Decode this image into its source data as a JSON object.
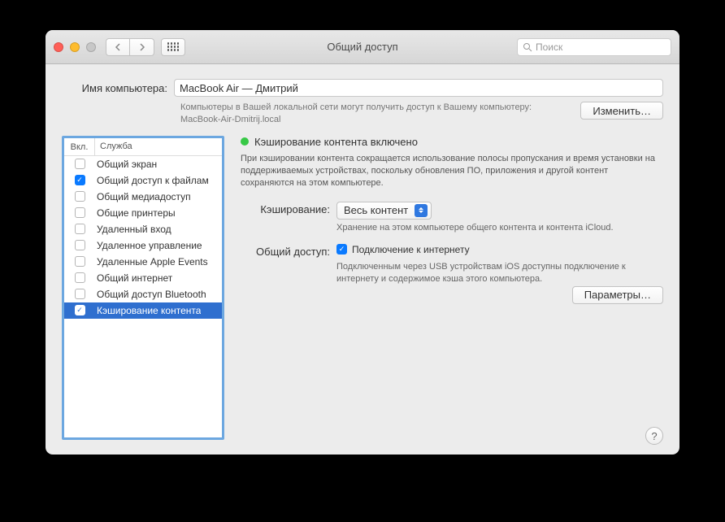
{
  "window": {
    "title": "Общий доступ"
  },
  "search": {
    "placeholder": "Поиск"
  },
  "top": {
    "label": "Имя компьютера:",
    "value": "MacBook Air — Дмитрий",
    "subtext": "Компьютеры в Вашей локальной сети могут получить доступ к Вашему компьютеру: MacBook-Air-Dmitrij.local",
    "editBtn": "Изменить…"
  },
  "servicesHeader": {
    "col1": "Вкл.",
    "col2": "Служба"
  },
  "services": [
    {
      "label": "Общий экран",
      "on": false,
      "sel": false
    },
    {
      "label": "Общий доступ к файлам",
      "on": true,
      "sel": false
    },
    {
      "label": "Общий медиадоступ",
      "on": false,
      "sel": false
    },
    {
      "label": "Общие принтеры",
      "on": false,
      "sel": false
    },
    {
      "label": "Удаленный вход",
      "on": false,
      "sel": false
    },
    {
      "label": "Удаленное управление",
      "on": false,
      "sel": false
    },
    {
      "label": "Удаленные Apple Events",
      "on": false,
      "sel": false
    },
    {
      "label": "Общий интернет",
      "on": false,
      "sel": false
    },
    {
      "label": "Общий доступ Bluetooth",
      "on": false,
      "sel": false
    },
    {
      "label": "Кэширование контента",
      "on": true,
      "sel": true
    }
  ],
  "detail": {
    "statusTitle": "Кэширование контента включено",
    "statusDesc": "При кэшировании контента сокращается использование полосы пропускания и время установки на поддерживаемых устройствах, поскольку обновления ПО, приложения и другой контент сохраняются на этом компьютере.",
    "cacheLabel": "Кэширование:",
    "cacheValue": "Весь контент",
    "cacheHint": "Хранение на этом компьютере общего контента и контента iCloud.",
    "shareLabel": "Общий доступ:",
    "shareCheckboxLabel": "Подключение к интернету",
    "shareHint": "Подключенным через USB устройствам iOS доступны подключение к интернету и содержимое кэша этого компьютера.",
    "paramsBtn": "Параметры…"
  }
}
